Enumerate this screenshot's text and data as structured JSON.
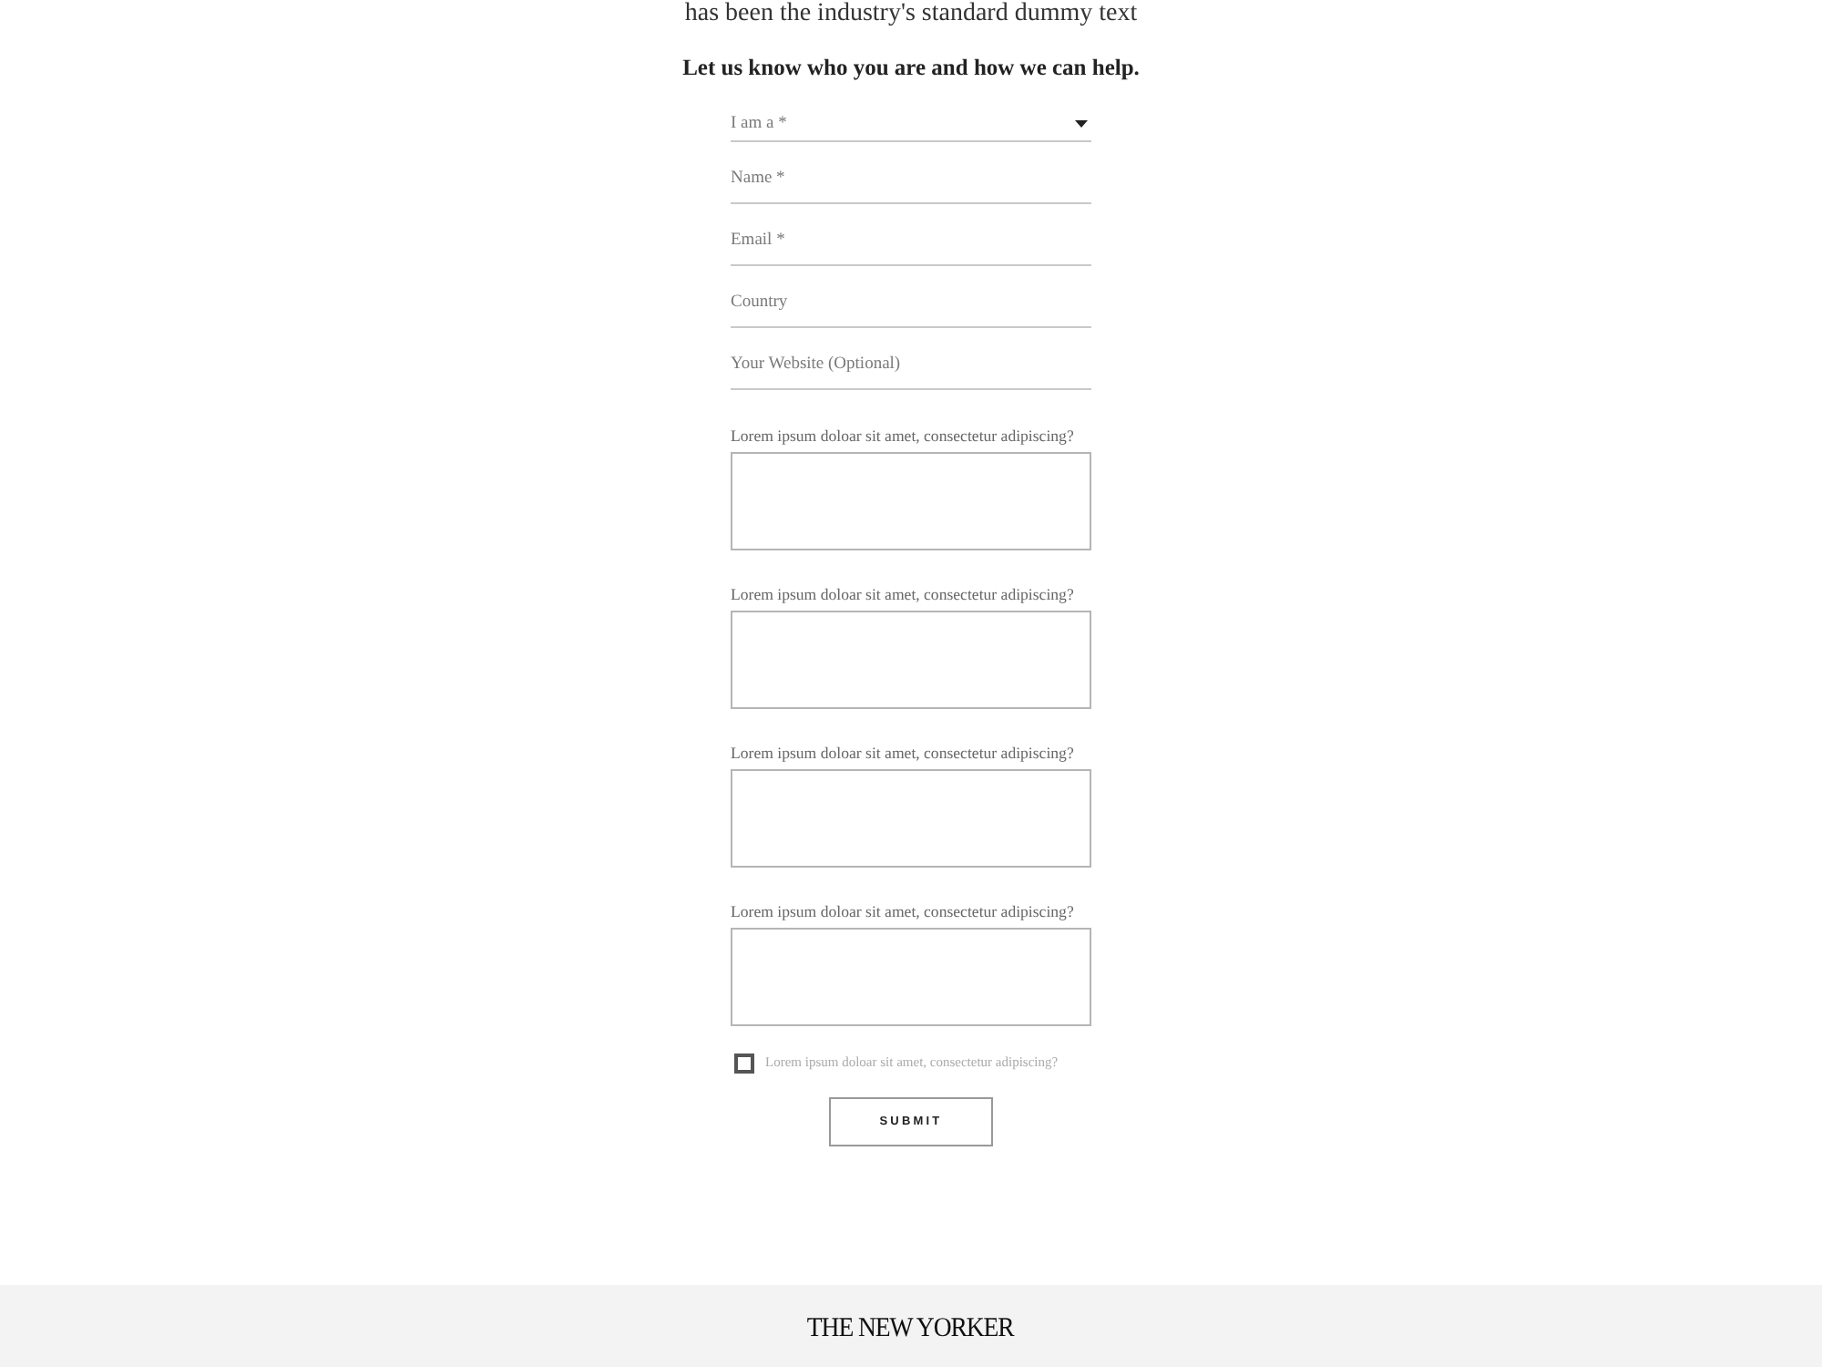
{
  "intro": {
    "text": "has been the industry's standard dummy text"
  },
  "form": {
    "heading": "Let us know who you are and how we can help.",
    "fields": [
      {
        "kind": "select",
        "placeholder": "I am a *"
      },
      {
        "kind": "text",
        "placeholder": "Name *"
      },
      {
        "kind": "text",
        "placeholder": "Email *"
      },
      {
        "kind": "text",
        "placeholder": "Country"
      },
      {
        "kind": "text",
        "placeholder": "Your Website (Optional)"
      }
    ],
    "questions": [
      {
        "label": "Lorem ipsum doloar sit amet, consectetur adipiscing?"
      },
      {
        "label": "Lorem ipsum doloar sit amet, consectetur adipiscing?"
      },
      {
        "label": "Lorem ipsum doloar sit amet, consectetur adipiscing?"
      },
      {
        "label": "Lorem ipsum doloar sit amet, consectetur adipiscing?"
      }
    ],
    "consent": {
      "label": "Lorem ipsum doloar sit amet, consectetur adipiscing?",
      "checked": false
    },
    "submit": "SUBMIT"
  },
  "footer": {
    "logo": "THE NEW YORKER"
  }
}
